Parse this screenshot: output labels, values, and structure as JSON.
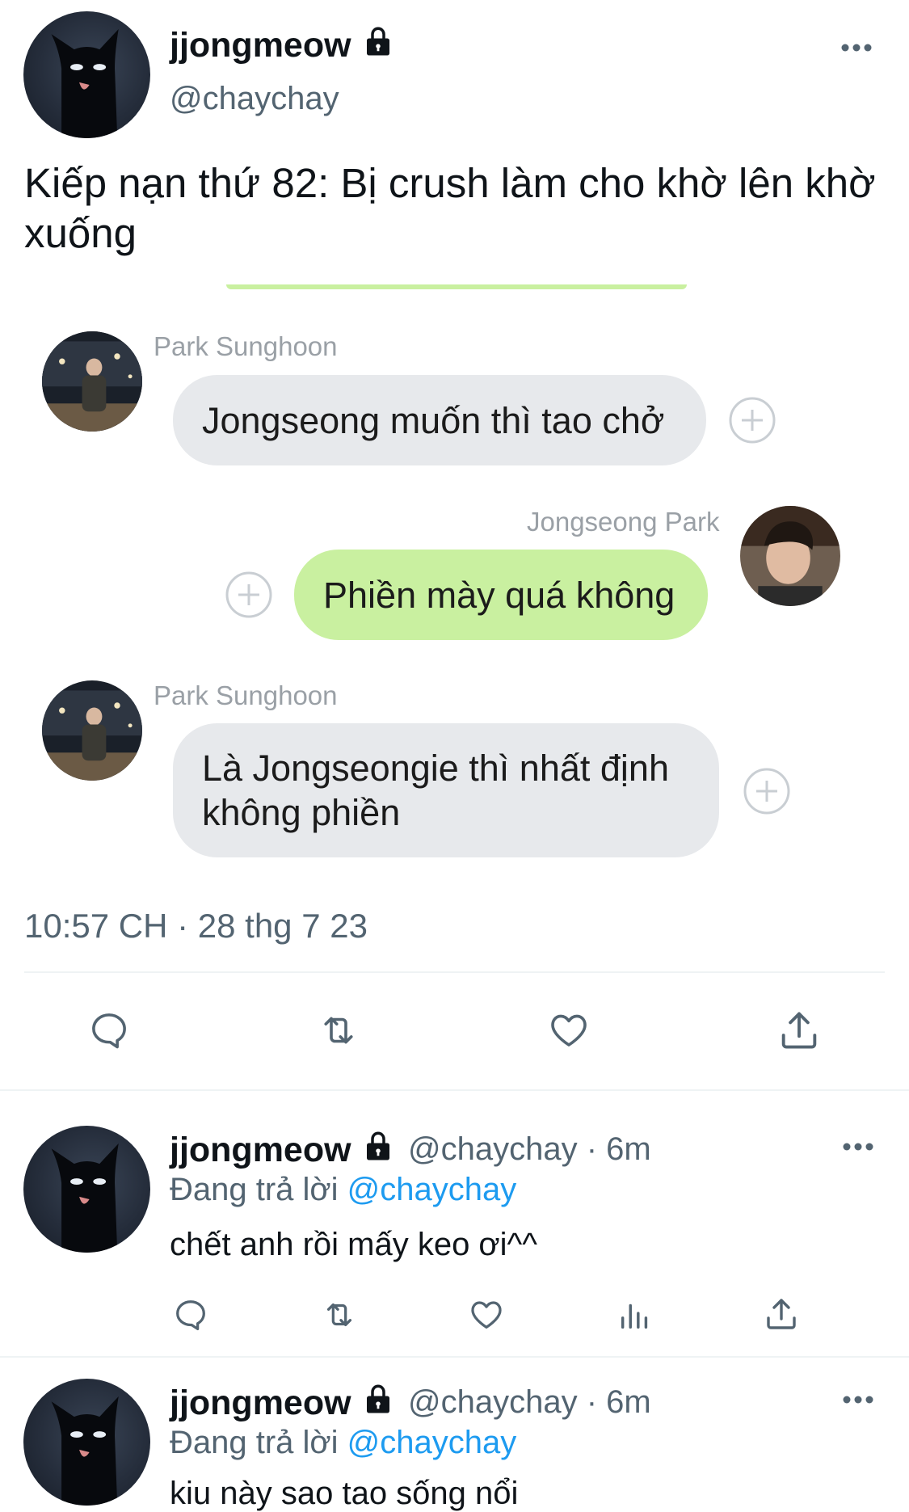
{
  "main_tweet": {
    "display_name": "jjongmeow",
    "handle": "@chaychay",
    "text": "Kiếp nạn thứ 82: Bị crush làm cho khờ lên khờ xuống",
    "timestamp": "10:57 CH · 28 thg 7 23"
  },
  "chat": {
    "messages": [
      {
        "sender": "Park Sunghoon",
        "text": "Jongseong muốn thì tao chở"
      },
      {
        "sender": "Jongseong Park",
        "text": "Phiền mày quá không"
      },
      {
        "sender": "Park Sunghoon",
        "text": "Là Jongseongie thì nhất định không phiền"
      }
    ]
  },
  "replies": [
    {
      "display_name": "jjongmeow",
      "handle_time": "@chaychay · 6m",
      "replying_prefix": "Đang trả lời",
      "replying_to": "@chaychay",
      "text": "chết anh rồi mấy keo ơi^^"
    },
    {
      "display_name": "jjongmeow",
      "handle_time": "@chaychay · 6m",
      "replying_prefix": "Đang trả lời",
      "replying_to": "@chaychay",
      "text": "kiu này sao tao sống nổi"
    }
  ],
  "colors": {
    "accent": "#1d9bf0",
    "bubble_green": "#c9f0a0",
    "bubble_gray": "#e7e9ec",
    "muted": "#536471"
  },
  "icons": [
    "lock-icon",
    "more-icon",
    "reply-icon",
    "retweet-icon",
    "like-icon",
    "share-icon",
    "views-icon",
    "plus-icon"
  ]
}
